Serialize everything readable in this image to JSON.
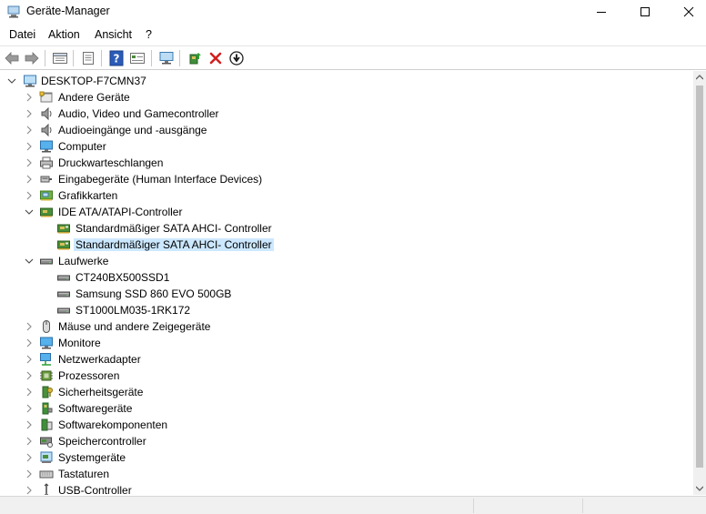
{
  "window": {
    "title": "Geräte-Manager"
  },
  "menu": [
    "Datei",
    "Aktion",
    "Ansicht",
    "?"
  ],
  "toolbar": [
    "back-icon",
    "forward-icon",
    "properties-icon",
    "properties-page-icon",
    "help-icon",
    "view-icon",
    "scan-hardware-icon",
    "update-driver-icon",
    "uninstall-icon",
    "disable-device-icon"
  ],
  "tree": {
    "root": "DESKTOP-F7CMN37",
    "items": [
      {
        "label": "Andere Geräte",
        "icon": "unknown-device-icon"
      },
      {
        "label": "Audio, Video und Gamecontroller",
        "icon": "speaker-icon"
      },
      {
        "label": "Audioeingänge und -ausgänge",
        "icon": "speaker-icon"
      },
      {
        "label": "Computer",
        "icon": "monitor-icon"
      },
      {
        "label": "Druckwarteschlangen",
        "icon": "printer-icon"
      },
      {
        "label": "Eingabegeräte (Human Interface Devices)",
        "icon": "hid-icon"
      },
      {
        "label": "Grafikkarten",
        "icon": "display-adapter-icon"
      },
      {
        "label": "IDE ATA/ATAPI-Controller",
        "icon": "controller-icon",
        "expanded": true,
        "children": [
          {
            "label": "Standardmäßiger SATA AHCI- Controller"
          },
          {
            "label": "Standardmäßiger SATA AHCI- Controller",
            "selected": true
          }
        ]
      },
      {
        "label": "Laufwerke",
        "icon": "drive-icon",
        "expanded": true,
        "children": [
          {
            "label": "CT240BX500SSD1"
          },
          {
            "label": "Samsung SSD 860 EVO 500GB"
          },
          {
            "label": "ST1000LM035-1RK172"
          }
        ]
      },
      {
        "label": "Mäuse und andere Zeigegeräte",
        "icon": "mouse-icon"
      },
      {
        "label": "Monitore",
        "icon": "monitor-icon"
      },
      {
        "label": "Netzwerkadapter",
        "icon": "network-icon"
      },
      {
        "label": "Prozessoren",
        "icon": "processor-icon"
      },
      {
        "label": "Sicherheitsgeräte",
        "icon": "security-device-icon"
      },
      {
        "label": "Softwaregeräte",
        "icon": "software-device-icon"
      },
      {
        "label": "Softwarekomponenten",
        "icon": "software-component-icon"
      },
      {
        "label": "Speichercontroller",
        "icon": "storage-controller-icon"
      },
      {
        "label": "Systemgeräte",
        "icon": "system-device-icon"
      },
      {
        "label": "Tastaturen",
        "icon": "keyboard-icon"
      },
      {
        "label": "USB-Controller",
        "icon": "usb-icon"
      }
    ]
  }
}
